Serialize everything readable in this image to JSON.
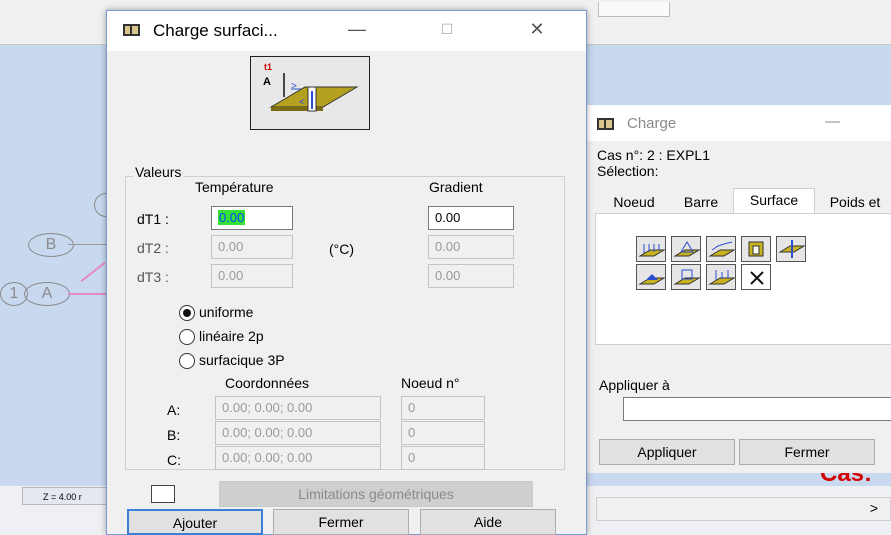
{
  "background": {
    "node_labels": [
      "B",
      "1",
      "A"
    ],
    "status_z": "Z = 4.00 r",
    "cas_label": "Cas:",
    "scroll_arrow": ">"
  },
  "dialog": {
    "title": "Charge surfaci...",
    "window_buttons": {
      "minimize": "—",
      "maximize": "☐",
      "close": "✕"
    },
    "preview_labels": {
      "t1": "t1",
      "a": "A",
      "arrow_right": ">",
      "arrow_left": "<"
    },
    "valeurs": {
      "group_label": "Valeurs",
      "temperature_header": "Température",
      "gradient_header": "Gradient",
      "unit": "(°C)",
      "rows": [
        {
          "label": "dT1 :",
          "temperature": "0.00",
          "gradient": "0.00"
        },
        {
          "label": "dT2 :",
          "temperature": "0.00",
          "gradient": "0.00"
        },
        {
          "label": "dT3 :",
          "temperature": "0.00",
          "gradient": "0.00"
        }
      ]
    },
    "distribution": {
      "options": [
        "uniforme",
        "linéaire 2p",
        "surfacique 3P"
      ],
      "selected": "uniforme"
    },
    "points": {
      "coord_header": "Coordonnées",
      "node_header": "Noeud n°",
      "rows": [
        {
          "label": "A:",
          "coords": "0.00; 0.00; 0.00",
          "node": "0"
        },
        {
          "label": "B:",
          "coords": "0.00; 0.00; 0.00",
          "node": "0"
        },
        {
          "label": "C:",
          "coords": "0.00; 0.00; 0.00",
          "node": "0"
        }
      ]
    },
    "limitations_button": "Limitations géométriques",
    "buttons": {
      "add": "Ajouter",
      "close": "Fermer",
      "help": "Aide"
    }
  },
  "charge_dialog": {
    "title": "Charge",
    "minimize": "—",
    "case_line": "Cas n°: 2 : EXPL1",
    "selection_label": "Sélection:",
    "tabs": [
      "Noeud",
      "Barre",
      "Surface",
      "Poids et"
    ],
    "active_tab": "Surface",
    "apply_group_label": "Appliquer à",
    "apply_value": "",
    "buttons": {
      "apply": "Appliquer",
      "close": "Fermer"
    }
  },
  "colors": {
    "selected_field": "#35e035",
    "selected_text": "#0047ff",
    "cas_red": "#d40000",
    "default_button_border": "#3c7fd9"
  }
}
